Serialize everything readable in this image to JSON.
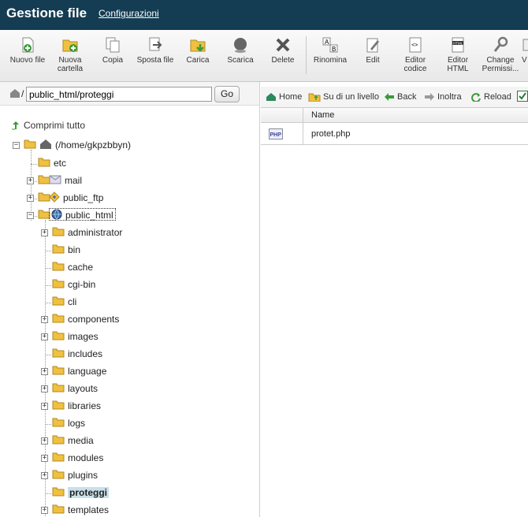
{
  "header": {
    "title": "Gestione file",
    "settings_link": "Configurazioni"
  },
  "toolbar": {
    "buttons": [
      {
        "label": "Nuovo file",
        "icon": "new-file-icon"
      },
      {
        "label": "Nuova cartella",
        "icon": "new-folder-icon"
      },
      {
        "label": "Copia",
        "icon": "copy-icon"
      },
      {
        "label": "Sposta file",
        "icon": "move-icon"
      },
      {
        "label": "Carica",
        "icon": "upload-icon"
      },
      {
        "label": "Scarica",
        "icon": "download-icon"
      },
      {
        "label": "Delete",
        "icon": "delete-icon"
      },
      {
        "label": "Rinomina",
        "icon": "rename-icon"
      },
      {
        "label": "Edit",
        "icon": "edit-icon"
      },
      {
        "label": "Editor codice",
        "icon": "code-editor-icon"
      },
      {
        "label": "Editor HTML",
        "icon": "html-editor-icon"
      },
      {
        "label": "Change Permissi...",
        "icon": "permissions-icon"
      },
      {
        "label": "V",
        "icon": "view-icon"
      }
    ]
  },
  "pathbar": {
    "path_value": "public_html/proteggi",
    "go_label": "Go",
    "slash": "/"
  },
  "nav": {
    "home": "Home",
    "up": "Su di un livello",
    "back": "Back",
    "forward": "Inoltra",
    "reload": "Reload"
  },
  "tree": {
    "collapse_all": "Comprimi tutto",
    "root": "(/home/gkpzbbyn)",
    "level1": [
      "etc",
      "mail",
      "public_ftp",
      "public_html"
    ],
    "public_html_children": [
      "administrator",
      "bin",
      "cache",
      "cgi-bin",
      "cli",
      "components",
      "images",
      "includes",
      "language",
      "layouts",
      "libraries",
      "logs",
      "media",
      "modules",
      "plugins",
      "proteggi",
      "templates"
    ],
    "selected": "proteggi"
  },
  "filelist": {
    "column_name": "Name",
    "rows": [
      {
        "name": "protet.php",
        "icon": "php-file-icon"
      }
    ]
  },
  "colors": {
    "header_bg": "#143c52",
    "selected_bg": "#c8e0ea",
    "folder": "#f0c040"
  }
}
